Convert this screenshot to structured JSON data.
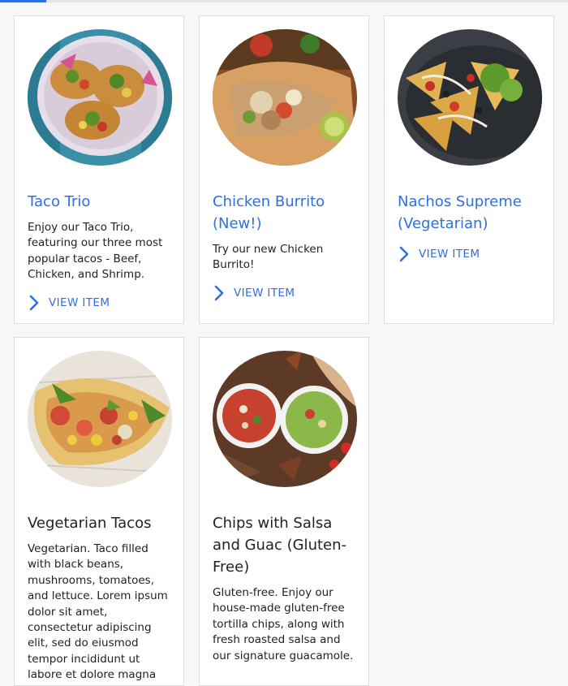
{
  "colors": {
    "accent": "#2f6fe0",
    "card_border": "#dedede",
    "background": "#f7f7f7"
  },
  "menu_items": [
    {
      "title": "Taco Trio",
      "description": "Enjoy our Taco Trio, featuring our three most popular tacos - Beef, Chicken, and Shrimp.",
      "link_label": "VIEW ITEM",
      "image": "taco-trio-photo"
    },
    {
      "title": "Chicken Burrito (New!)",
      "description": "Try our new Chicken Burrito!",
      "link_label": "VIEW ITEM",
      "image": "chicken-burrito-photo"
    },
    {
      "title": "Nachos Supreme (Vegetarian)",
      "description": "",
      "link_label": "VIEW ITEM",
      "image": "nachos-supreme-photo"
    },
    {
      "title": "Vegetarian Tacos",
      "description": "Vegetarian. Taco filled with black beans, mushrooms, tomatoes, and lettuce. Lorem ipsum dolor sit amet, consectetur adipiscing elit, sed do eiusmod tempor incididunt ut labore et dolore magna aliqua. Ut enim ad minim",
      "image": "vegetarian-tacos-photo"
    },
    {
      "title": "Chips with Salsa and Guac (Gluten-Free)",
      "description": "Gluten-free. Enjoy our house-made gluten-free tortilla chips, along with fresh roasted salsa and our signature guacamole.",
      "image": "chips-salsa-guac-photo"
    }
  ]
}
